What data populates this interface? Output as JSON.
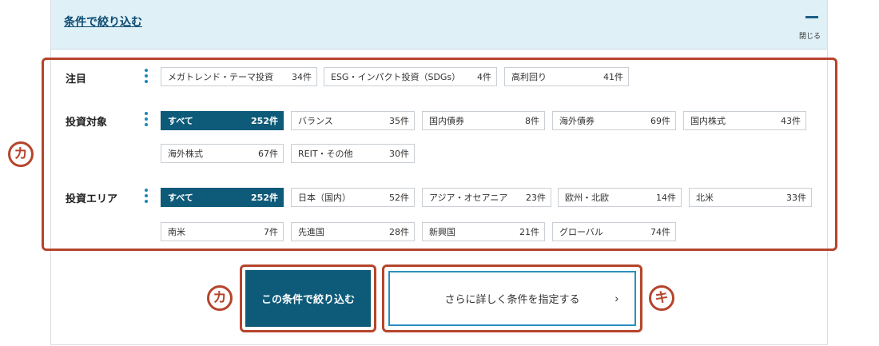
{
  "header": {
    "title": "条件で絞り込む",
    "close_label": "閉じる"
  },
  "badges": {
    "ka": "カ",
    "ki": "キ"
  },
  "rows": {
    "attention": {
      "label": "注目",
      "chips": [
        {
          "label": "メガトレンド・テーマ投資",
          "count": "34件"
        },
        {
          "label": "ESG・インパクト投資（SDGs）",
          "count": "4件"
        },
        {
          "label": "高利回り",
          "count": "41件"
        }
      ]
    },
    "target": {
      "label": "投資対象",
      "chips": [
        {
          "label": "すべて",
          "count": "252件"
        },
        {
          "label": "バランス",
          "count": "35件"
        },
        {
          "label": "国内債券",
          "count": "8件"
        },
        {
          "label": "海外債券",
          "count": "69件"
        },
        {
          "label": "国内株式",
          "count": "43件"
        },
        {
          "label": "海外株式",
          "count": "67件"
        },
        {
          "label": "REIT・その他",
          "count": "30件"
        }
      ]
    },
    "area": {
      "label": "投資エリア",
      "chips": [
        {
          "label": "すべて",
          "count": "252件"
        },
        {
          "label": "日本（国内）",
          "count": "52件"
        },
        {
          "label": "アジア・オセアニア",
          "count": "23件"
        },
        {
          "label": "欧州・北欧",
          "count": "14件"
        },
        {
          "label": "北米",
          "count": "33件"
        },
        {
          "label": "南米",
          "count": "7件"
        },
        {
          "label": "先進国",
          "count": "28件"
        },
        {
          "label": "新興国",
          "count": "21件"
        },
        {
          "label": "グローバル",
          "count": "74件"
        }
      ]
    }
  },
  "buttons": {
    "apply": "この条件で絞り込む",
    "more": "さらに詳しく条件を指定する",
    "chevron": "›"
  },
  "colors": {
    "accent": "#0e5a79",
    "annotation": "#b5452c",
    "header_bg": "#dff0f6"
  }
}
